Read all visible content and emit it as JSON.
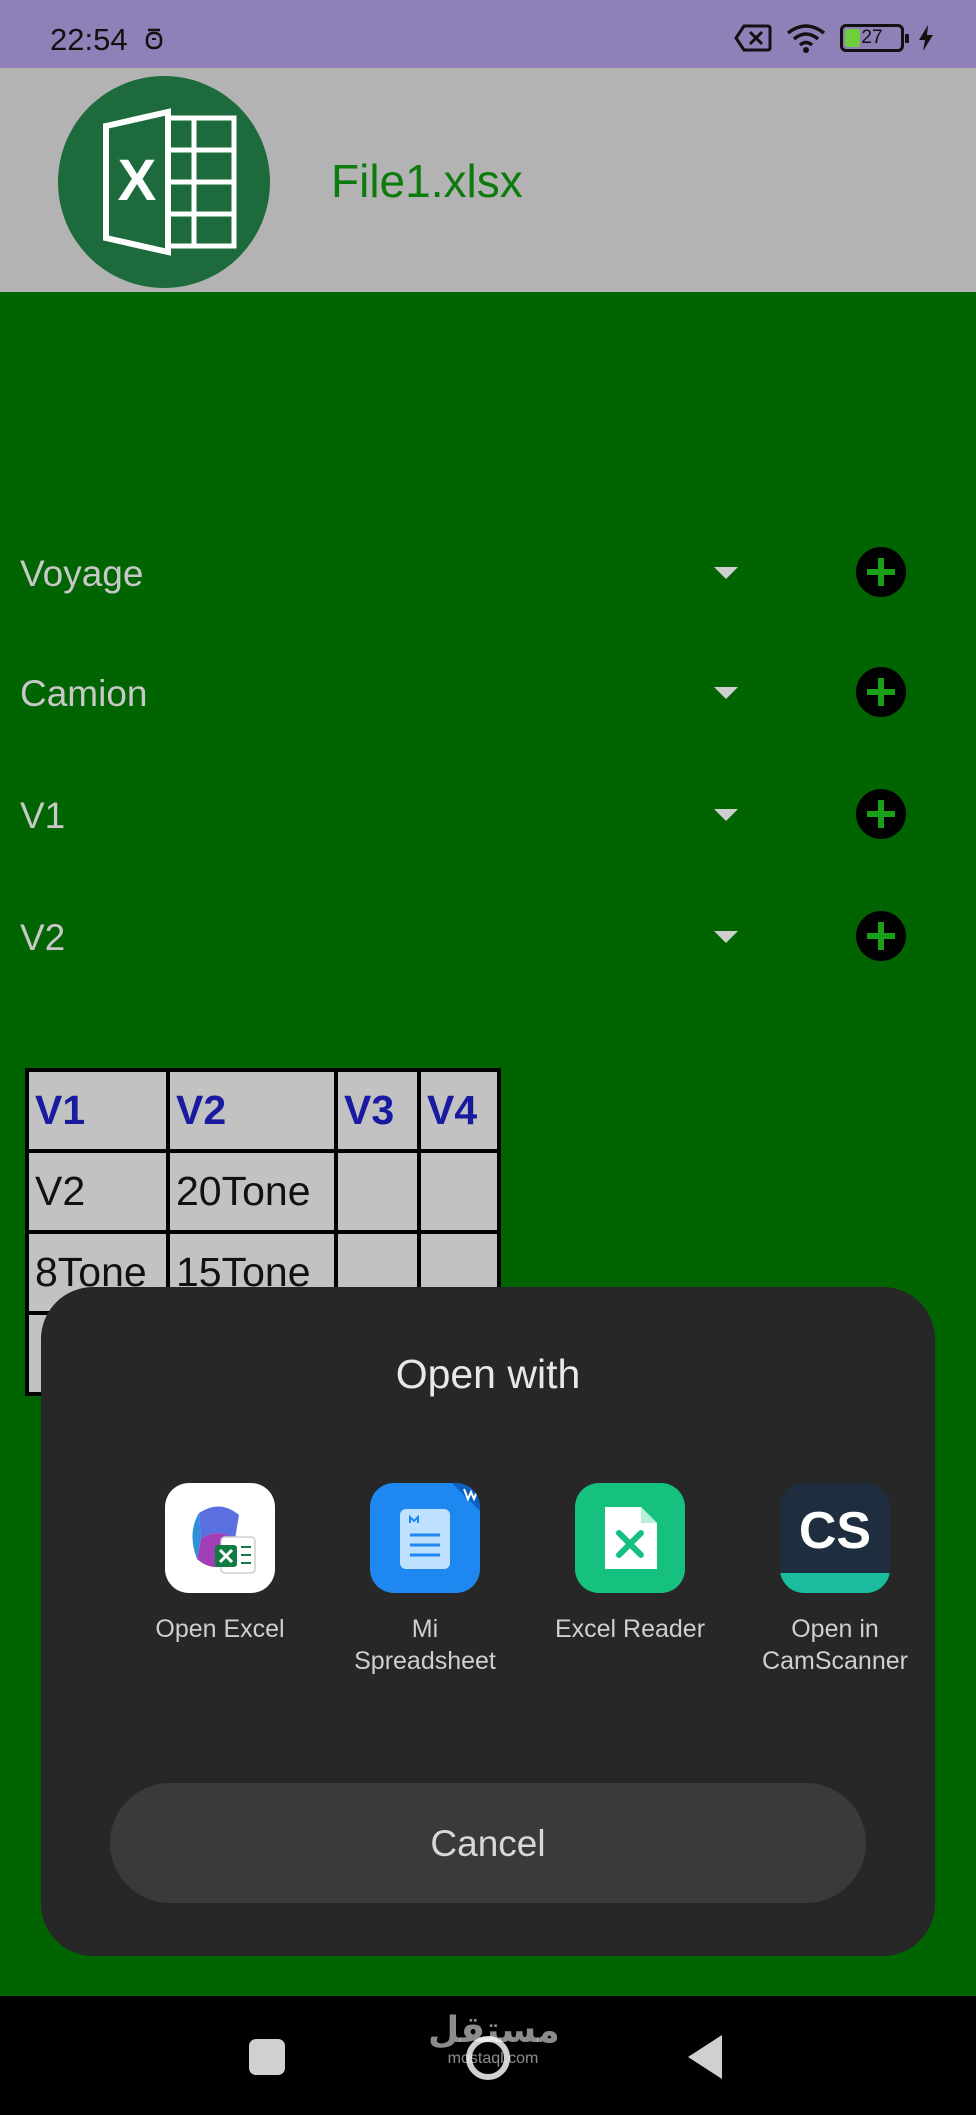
{
  "status_bar": {
    "time": "22:54",
    "battery_level": "27",
    "battery_fraction": 0.27,
    "icons": [
      "alarm-icon",
      "no-sim-icon",
      "wifi-icon",
      "battery-icon",
      "charging-icon"
    ]
  },
  "header": {
    "file_name": "File1.xlsx",
    "logo_icon": "excel-logo-icon",
    "logo_letter": "X"
  },
  "fields": [
    {
      "label": "Voyage"
    },
    {
      "label": "Camion"
    },
    {
      "label": "V1"
    },
    {
      "label": "V2"
    }
  ],
  "table": {
    "headers": [
      "V1",
      "V2",
      "V3",
      "V4"
    ],
    "rows": [
      [
        "V2",
        "20Tone",
        "",
        ""
      ],
      [
        "8Tone",
        "15Tone",
        "",
        ""
      ]
    ]
  },
  "dialog": {
    "title": "Open with",
    "apps": [
      {
        "label": "Open Excel",
        "icon": "microsoft-365-icon"
      },
      {
        "label": "Mi\nSpreadsheet",
        "icon": "mi-spreadsheet-icon"
      },
      {
        "label": "Excel Reader",
        "icon": "excel-reader-icon"
      },
      {
        "label": "Open in\nCamScanner",
        "icon": "camscanner-icon",
        "icon_text": "CS"
      }
    ],
    "cancel_label": "Cancel"
  },
  "nav_bar": {
    "icons": [
      "recents-icon",
      "home-icon",
      "back-icon"
    ],
    "watermark_main": "مستقل",
    "watermark_sub": "mostaql.com"
  },
  "colors": {
    "background": "#006400",
    "header_bg": "#b3b3b3",
    "status_bar": "#8f80b8",
    "file_title": "#0d7a0d",
    "dialog_bg": "#272727",
    "table_header_text": "#1a1aa0"
  }
}
